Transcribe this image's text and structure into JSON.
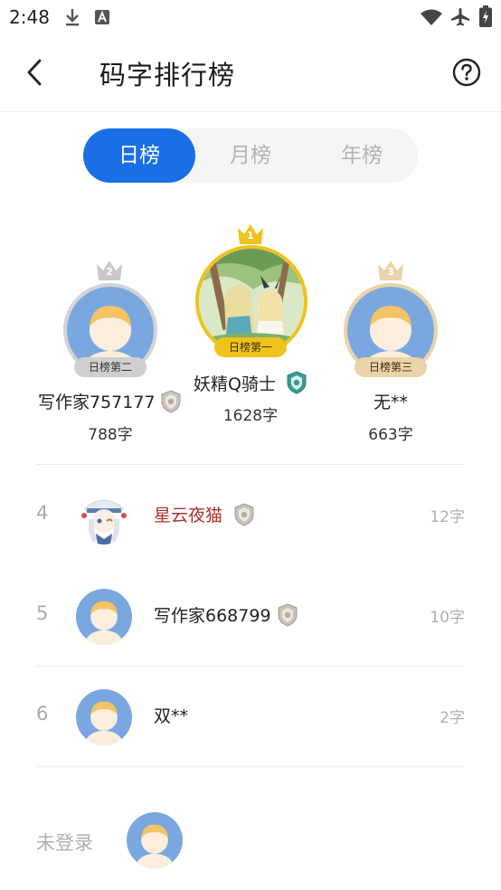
{
  "status_bar": {
    "time": "2:48",
    "icons": [
      "download-icon",
      "text-a-icon",
      "wifi-icon",
      "airplane-icon",
      "battery-charging-icon"
    ]
  },
  "header": {
    "title": "码字排行榜",
    "back_icon": "chevron-left-icon",
    "help_icon": "question-circle-icon"
  },
  "tabs": [
    {
      "label": "日榜",
      "active": true
    },
    {
      "label": "月榜",
      "active": false
    },
    {
      "label": "年榜",
      "active": false
    }
  ],
  "podium": {
    "first": {
      "rank": "1",
      "badge": "日榜第一",
      "name": "妖精Q骑士",
      "score": "1628字"
    },
    "second": {
      "rank": "2",
      "badge": "日榜第二",
      "name": "写作家757177",
      "score": "788字"
    },
    "third": {
      "rank": "3",
      "badge": "日榜第三",
      "name": "无**",
      "score": "663字"
    }
  },
  "list": [
    {
      "rank": "4",
      "name": "星云夜猫",
      "score": "12字"
    },
    {
      "rank": "5",
      "name": "写作家668799",
      "score": "10字"
    },
    {
      "rank": "6",
      "name": "双**",
      "score": "2字"
    }
  ],
  "bottom": {
    "login_label": "未登录"
  },
  "colors": {
    "accent": "#1a6fe6",
    "gold": "#f0c21c",
    "silver": "#c8c8c8",
    "bronze": "#ead3a8",
    "vip_name": "#b0302c"
  }
}
